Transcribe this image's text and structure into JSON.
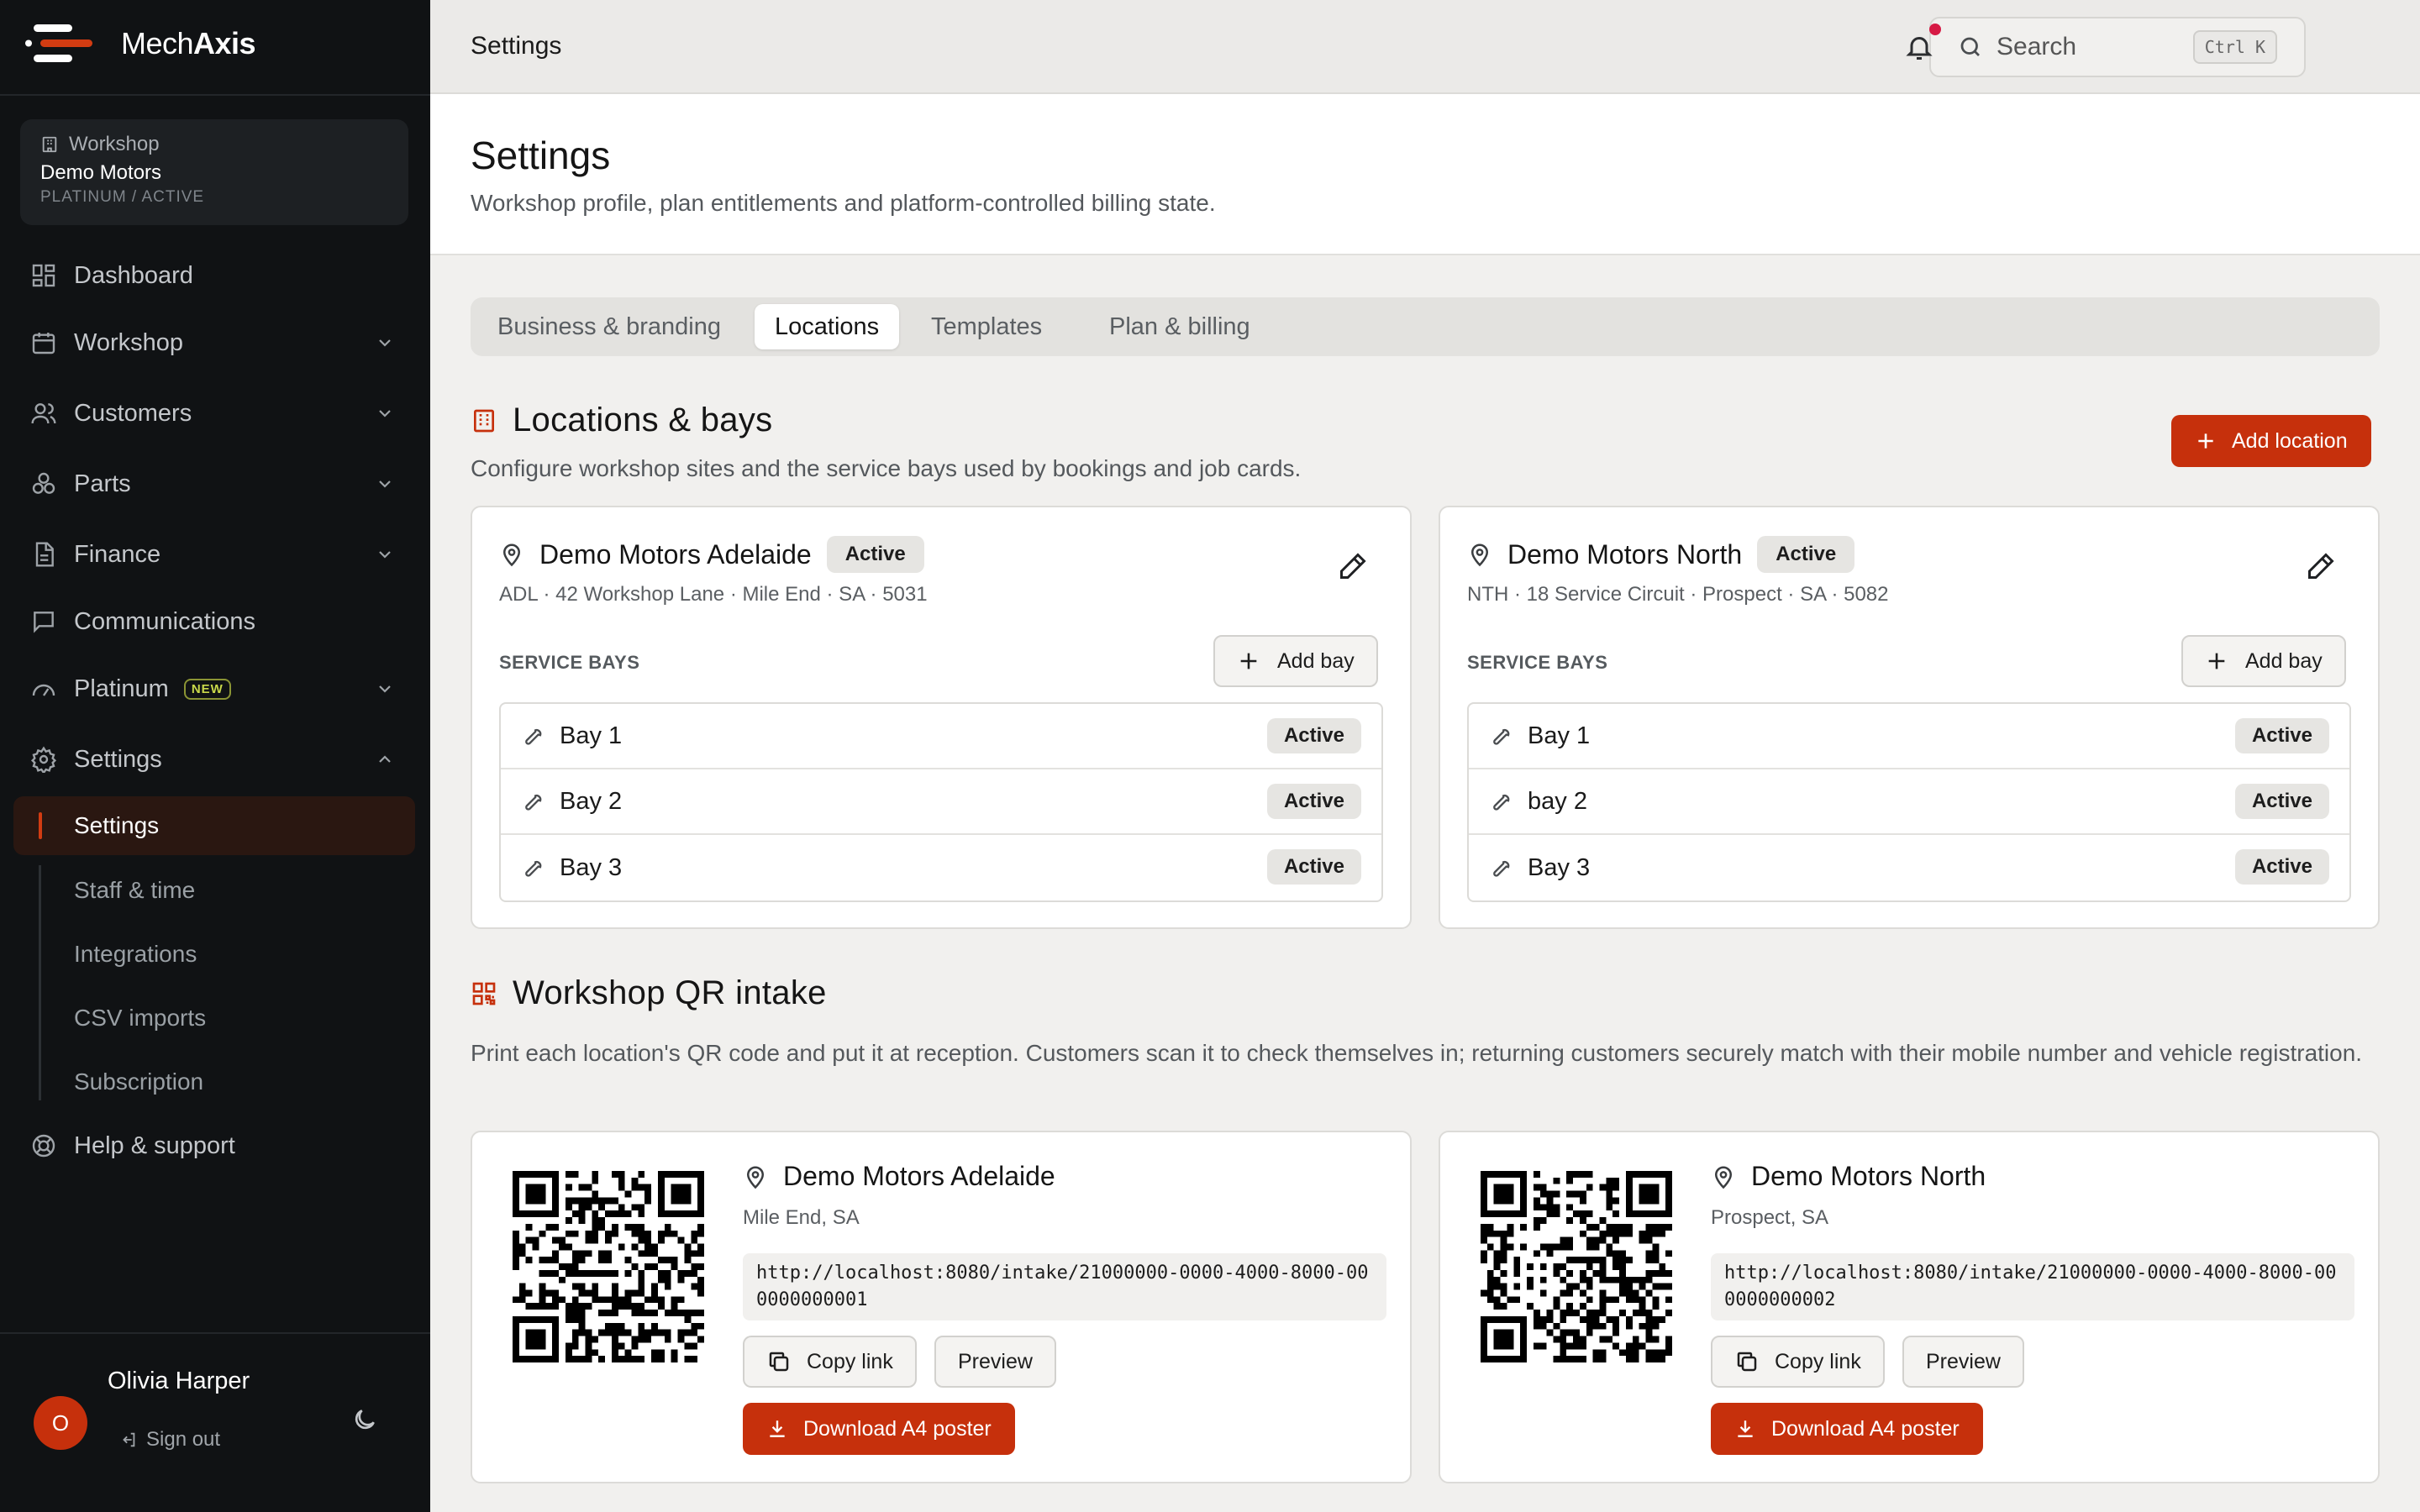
{
  "app": {
    "name_prefix": "Mech",
    "name_suffix": "Axis"
  },
  "workspace": {
    "label": "Workshop",
    "name": "Demo Motors",
    "plan": "PLATINUM / ACTIVE"
  },
  "nav": {
    "dashboard": "Dashboard",
    "workshop": "Workshop",
    "customers": "Customers",
    "parts": "Parts",
    "finance": "Finance",
    "communications": "Communications",
    "platinum": "Platinum",
    "platinum_badge": "NEW",
    "settings": "Settings",
    "sub": {
      "settings": "Settings",
      "staff_time": "Staff & time",
      "integrations": "Integrations",
      "csv_imports": "CSV imports",
      "subscription": "Subscription"
    },
    "help": "Help & support"
  },
  "user": {
    "initial": "O",
    "name": "Olivia Harper",
    "sign_out": "Sign out"
  },
  "topbar": {
    "title": "Settings",
    "search_label": "Search",
    "shortcut": "Ctrl K"
  },
  "page": {
    "title": "Settings",
    "subtitle": "Workshop profile, plan entitlements and platform-controlled billing state."
  },
  "tabs": [
    "Business & branding",
    "Locations",
    "Templates",
    "Plan & billing"
  ],
  "active_tab": "Locations",
  "locations_section": {
    "title": "Locations & bays",
    "description": "Configure workshop sites and the service bays used by bookings and job cards.",
    "add_label": "Add location",
    "bays_label": "SERVICE BAYS",
    "add_bay_label": "Add bay",
    "locations": [
      {
        "name": "Demo Motors Adelaide",
        "status": "Active",
        "address": "ADL · 42 Workshop Lane · Mile End · SA · 5031",
        "bays": [
          {
            "name": "Bay 1",
            "status": "Active"
          },
          {
            "name": "Bay 2",
            "status": "Active"
          },
          {
            "name": "Bay 3",
            "status": "Active"
          }
        ]
      },
      {
        "name": "Demo Motors North",
        "status": "Active",
        "address": "NTH · 18 Service Circuit · Prospect · SA · 5082",
        "bays": [
          {
            "name": "Bay 1",
            "status": "Active"
          },
          {
            "name": "bay 2",
            "status": "Active"
          },
          {
            "name": "Bay 3",
            "status": "Active"
          }
        ]
      }
    ]
  },
  "qr_section": {
    "title": "Workshop QR intake",
    "description": "Print each location's QR code and put it at reception. Customers scan it to check themselves in; returning customers securely match with their mobile number and vehicle registration.",
    "copy_label": "Copy link",
    "preview_label": "Preview",
    "download_label": "Download A4 poster",
    "items": [
      {
        "name": "Demo Motors Adelaide",
        "locality": "Mile End, SA",
        "url": "http://localhost:8080/intake/21000000-0000-4000-8000-000000000001"
      },
      {
        "name": "Demo Motors North",
        "locality": "Prospect, SA",
        "url": "http://localhost:8080/intake/21000000-0000-4000-8000-000000000002"
      }
    ]
  },
  "colors": {
    "accent": "#c6300c",
    "sidebar_bg": "#101214",
    "notification_dot": "#d61a44"
  }
}
